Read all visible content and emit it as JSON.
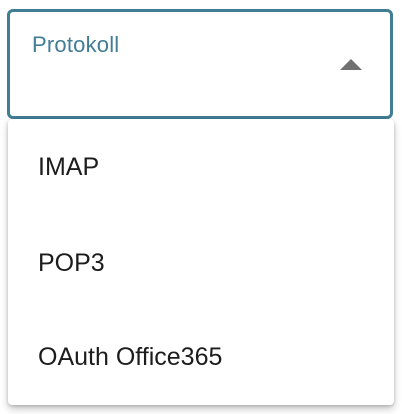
{
  "select": {
    "label": "Protokoll",
    "selected_value": "",
    "caret_icon": "caret-up-icon",
    "accent_color": "#417d95"
  },
  "dropdown": {
    "options": [
      {
        "label": "IMAP"
      },
      {
        "label": "POP3"
      },
      {
        "label": "OAuth Office365"
      }
    ]
  }
}
